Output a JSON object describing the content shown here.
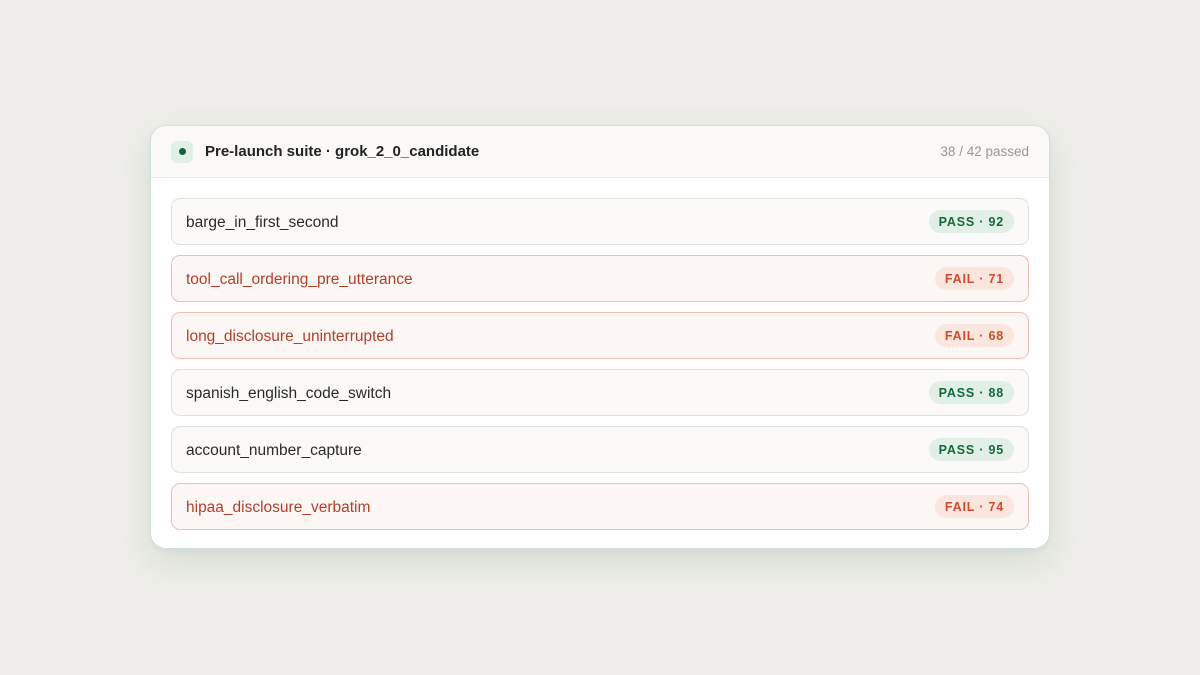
{
  "suite": {
    "title": "Pre-launch suite · grok_2_0_candidate",
    "summary": "38 / 42 passed",
    "status_color": "#12633a"
  },
  "tests": [
    {
      "name": "barge_in_first_second",
      "status": "pass",
      "badge": "PASS · 92"
    },
    {
      "name": "tool_call_ordering_pre_utterance",
      "status": "fail",
      "badge": "FAIL · 71"
    },
    {
      "name": "long_disclosure_uninterrupted",
      "status": "fail",
      "badge": "FAIL · 68"
    },
    {
      "name": "spanish_english_code_switch",
      "status": "pass",
      "badge": "PASS · 88"
    },
    {
      "name": "account_number_capture",
      "status": "pass",
      "badge": "PASS · 95"
    },
    {
      "name": "hipaa_disclosure_verbatim",
      "status": "fail",
      "badge": "FAIL · 74"
    }
  ],
  "colors": {
    "pass_text": "#146a3d",
    "pass_bg": "#e1efe6",
    "fail_text": "#d14b2b",
    "fail_bg": "#fbe5df"
  }
}
